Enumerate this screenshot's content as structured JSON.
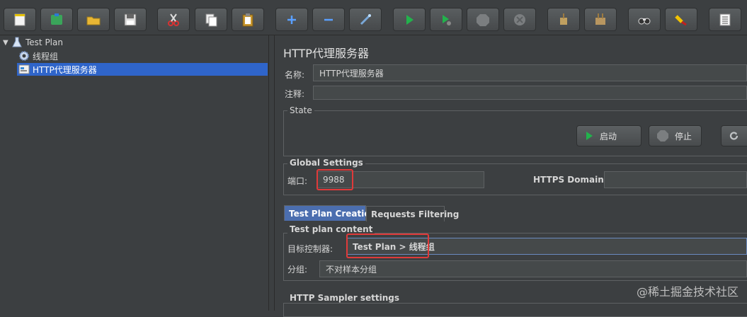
{
  "tree": {
    "items": [
      {
        "label": "Test Plan",
        "icon": "flask-icon"
      },
      {
        "label": "线程组",
        "icon": "gear-icon"
      },
      {
        "label": "HTTP代理服务器",
        "icon": "proxy-icon"
      }
    ]
  },
  "panel": {
    "title": "HTTP代理服务器",
    "name_label": "名称:",
    "name_value": "HTTP代理服务器",
    "comment_label": "注释:",
    "comment_value": "",
    "state": {
      "title": "State",
      "start_label": "启动",
      "stop_label": "停止"
    },
    "global": {
      "title": "Global Settings",
      "port_label": "端口:",
      "port_value": "9988",
      "https_label": "HTTPS Domains:",
      "https_value": ""
    },
    "tabs": [
      {
        "label": "Test Plan Creation"
      },
      {
        "label": "Requests Filtering"
      }
    ],
    "content": {
      "title": "Test plan content",
      "target_label": "目标控制器:",
      "target_value": "Test Plan > 线程组",
      "grouping_label": "分组:",
      "grouping_value": "不对样本分组"
    },
    "sampler": {
      "title": "HTTP Sampler settings"
    }
  },
  "watermark": "@稀土掘金技术社区",
  "colors": {
    "background": "#3c3f41",
    "selection": "#2f65ca",
    "active_tab": "#4b6eaf",
    "highlight": "#e03a3a"
  }
}
